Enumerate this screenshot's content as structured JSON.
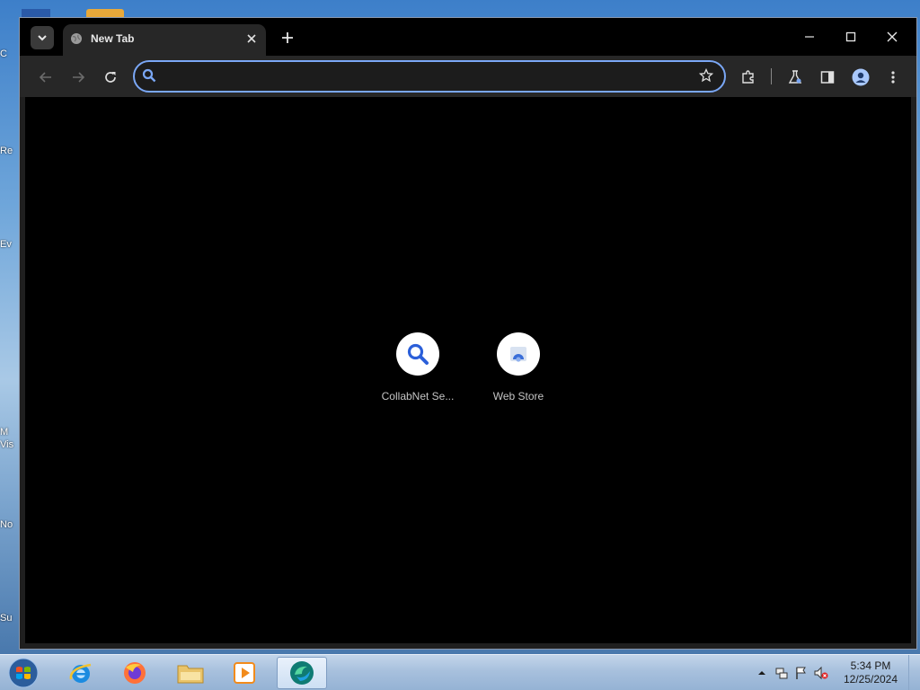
{
  "desktop": {
    "icon_fragments": [
      "C",
      "Re",
      "Ev",
      "",
      "M\nVis",
      "No",
      "Su"
    ]
  },
  "browser": {
    "tab": {
      "title": "New Tab"
    },
    "omnibox": {
      "value": "",
      "placeholder": ""
    },
    "shortcuts": [
      {
        "label": "CollabNet Se...",
        "icon": "search-icon"
      },
      {
        "label": "Web Store",
        "icon": "web-store-icon"
      }
    ],
    "accent_color": "#7aa7f5"
  },
  "taskbar": {
    "apps": [
      "internet-explorer-icon",
      "firefox-icon",
      "file-explorer-icon",
      "media-player-icon",
      "browser-app-icon"
    ],
    "clock": {
      "time": "5:34 PM",
      "date": "12/25/2024"
    }
  }
}
